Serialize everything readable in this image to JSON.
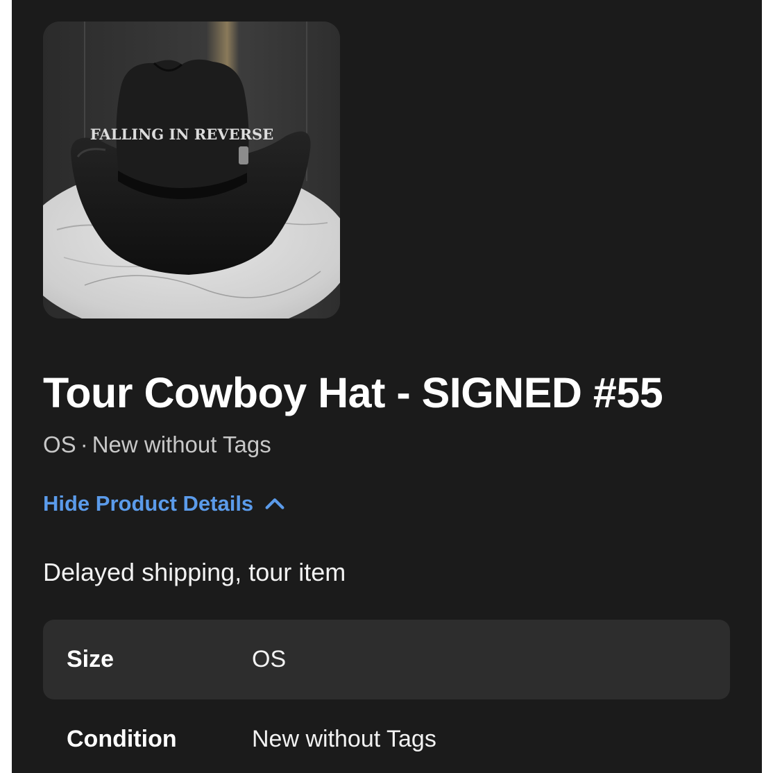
{
  "product": {
    "title": "Tour Cowboy Hat - SIGNED #55",
    "size_short": "OS",
    "separator": "·",
    "condition_short": "New without Tags",
    "image": {
      "icon": "cowboy-hat-photo",
      "brand_text": "FALLING IN REVERSE"
    },
    "details_toggle_label": "Hide Product Details",
    "description": "Delayed shipping, tour item",
    "details": [
      {
        "label": "Size",
        "value": "OS"
      },
      {
        "label": "Condition",
        "value": "New without Tags"
      }
    ]
  },
  "colors": {
    "background": "#1b1b1b",
    "link": "#5b9bea",
    "row_shade": "#2d2d2d"
  }
}
